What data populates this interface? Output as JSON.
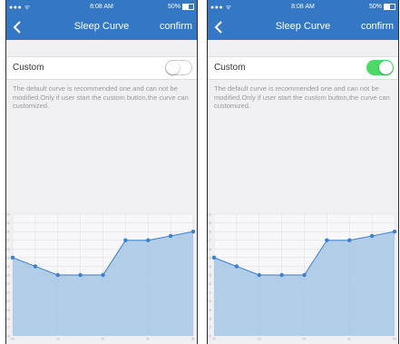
{
  "screens": [
    {
      "status": {
        "signal": "●●● ᯤ",
        "time": "8:08 AM",
        "battery": "50%"
      },
      "nav": {
        "title": "Sleep Curve",
        "confirm": "confirm"
      },
      "custom": {
        "label": "Custom",
        "toggle_on": false
      },
      "description": "The default curve is recommended one and can not be modified.Only if user start the custom button,the curve can customized."
    },
    {
      "status": {
        "signal": "●●● ᯤ",
        "time": "8:08 AM",
        "battery": "50%"
      },
      "nav": {
        "title": "Sleep Curve",
        "confirm": "confirm"
      },
      "custom": {
        "label": "Custom",
        "toggle_on": true
      },
      "description": "The default curve is recommended one and can not be modified.Only if user start the custom button,the curve can customized."
    }
  ],
  "colors": {
    "header": "#3477c4",
    "toggle_on": "#4cd964",
    "curve_fill": "#a9c8e6",
    "curve_line": "#3a7fd0"
  },
  "chart_data": {
    "type": "area",
    "x": [
      0,
      1,
      2,
      3,
      4,
      5,
      6,
      7,
      8
    ],
    "values": [
      25,
      24,
      23,
      23,
      23,
      27,
      27,
      27.5,
      28
    ],
    "ylim": [
      16,
      30
    ],
    "y_ticks": [
      16,
      17,
      18,
      19,
      20,
      21,
      22,
      23,
      24,
      25,
      26,
      27,
      28,
      29,
      30
    ],
    "x_ticks": [
      "0h",
      "2h",
      "4h",
      "6h",
      "8h"
    ],
    "xlim": [
      0,
      8
    ],
    "grid": true
  }
}
